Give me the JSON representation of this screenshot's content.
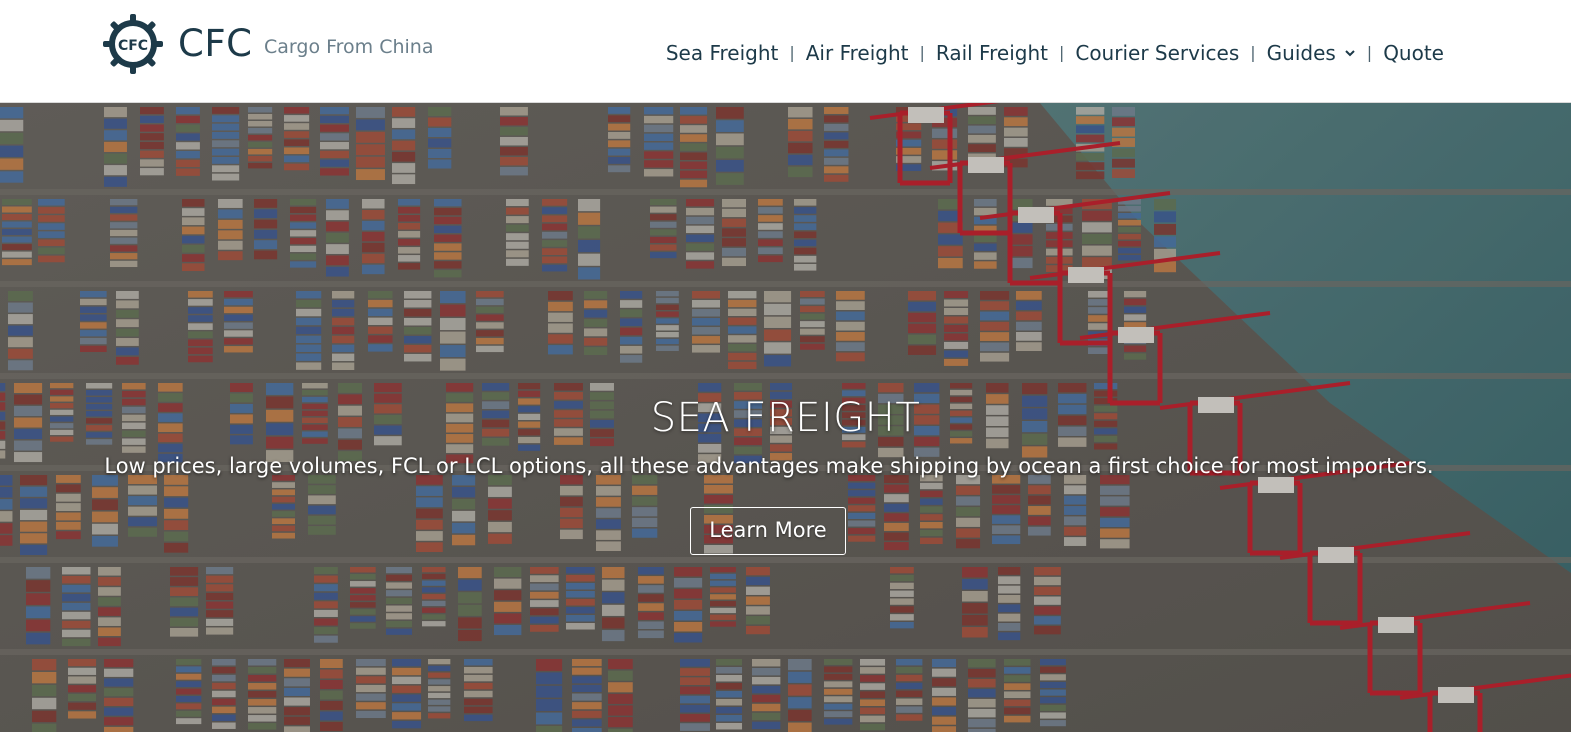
{
  "header": {
    "brand": "CFC",
    "tagline": "Cargo From China",
    "nav": [
      {
        "label": "Sea Freight"
      },
      {
        "label": "Air Freight"
      },
      {
        "label": "Rail Freight"
      },
      {
        "label": "Courier Services"
      },
      {
        "label": "Guides",
        "has_dropdown": true
      },
      {
        "label": "Quote"
      }
    ],
    "separator": "|"
  },
  "hero": {
    "title": "SEA FREIGHT",
    "subtitle": "Low prices, large volumes, FCL or LCL options, all these advantages make shipping by ocean a first choice for most importers.",
    "button_label": "Learn More"
  },
  "colors": {
    "brand_dark": "#1d3a49",
    "tagline": "#6b7f8b",
    "crane_red": "#c8202e",
    "water": "#4f7a7a"
  },
  "icons": {
    "logo": "ship-wheel-icon",
    "dropdown": "chevron-down-icon"
  }
}
